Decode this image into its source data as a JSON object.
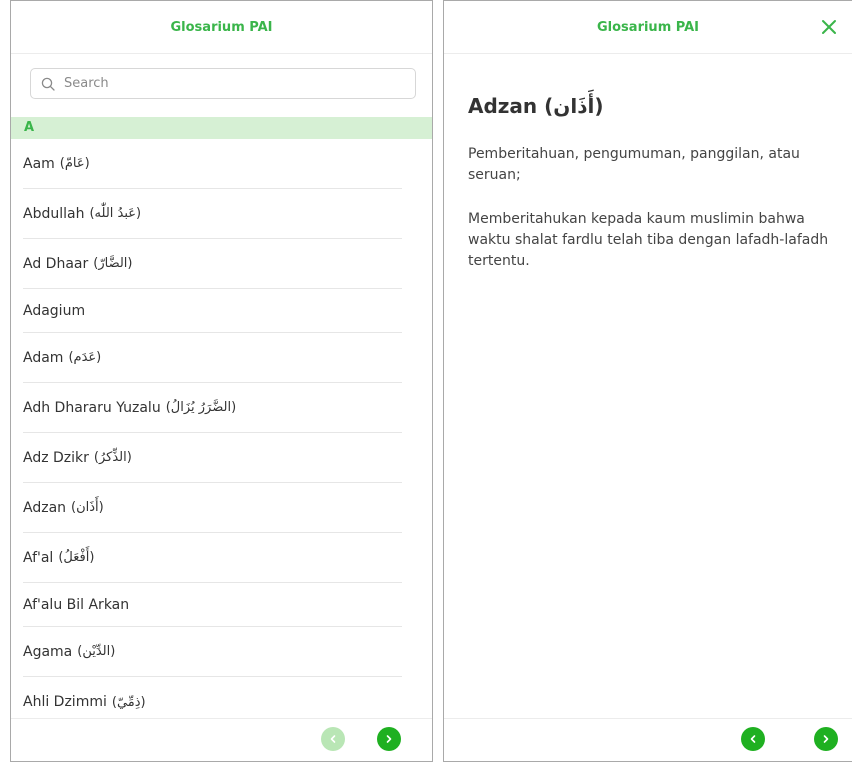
{
  "colors": {
    "accent": "#3ab54a",
    "button_green": "#1fb021",
    "button_disabled": "#b9e6b5",
    "section_bg": "#d6f0d4"
  },
  "left_panel": {
    "title": "Glosarium PAI",
    "search": {
      "placeholder": "Search",
      "value": ""
    },
    "section_letter": "A",
    "items": [
      {
        "name": "Aam",
        "arabic": "(عَامّ)"
      },
      {
        "name": "Abdullah",
        "arabic": "(عَبدُ اللّٰه)"
      },
      {
        "name": "Ad Dhaar",
        "arabic": "(الضَّارّ)"
      },
      {
        "name": "Adagium",
        "arabic": ""
      },
      {
        "name": "Adam",
        "arabic": "(عَدَم)"
      },
      {
        "name": "Adh Dhararu Yuzalu",
        "arabic": "(الضَّرَرُ يُزَالُ)"
      },
      {
        "name": "Adz Dzikr",
        "arabic": "(الذِّكرُ)"
      },
      {
        "name": "Adzan",
        "arabic": "(أَذَان)"
      },
      {
        "name": "Af'al",
        "arabic": "(أَفْعَلُ)"
      },
      {
        "name": "Af'alu Bil Arkan",
        "arabic": ""
      },
      {
        "name": "Agama",
        "arabic": "(الدِّيْن)"
      },
      {
        "name": "Ahli Dzimmi",
        "arabic": "(ذِمِّيّ)"
      }
    ],
    "footer": {
      "prev_icon": "chevron-left-icon",
      "next_icon": "chevron-right-icon"
    }
  },
  "right_panel": {
    "title": "Glosarium PAI",
    "close_icon": "close-icon",
    "entry_title": "Adzan (أَذَان)",
    "definitions": [
      "Pemberitahuan, pengumuman, panggilan, atau seruan;",
      "Memberitahukan kepada kaum muslimin bahwa waktu shalat fardlu telah tiba dengan lafadh-lafadh tertentu."
    ],
    "footer": {
      "prev_icon": "chevron-left-icon",
      "next_icon": "chevron-right-icon"
    }
  }
}
